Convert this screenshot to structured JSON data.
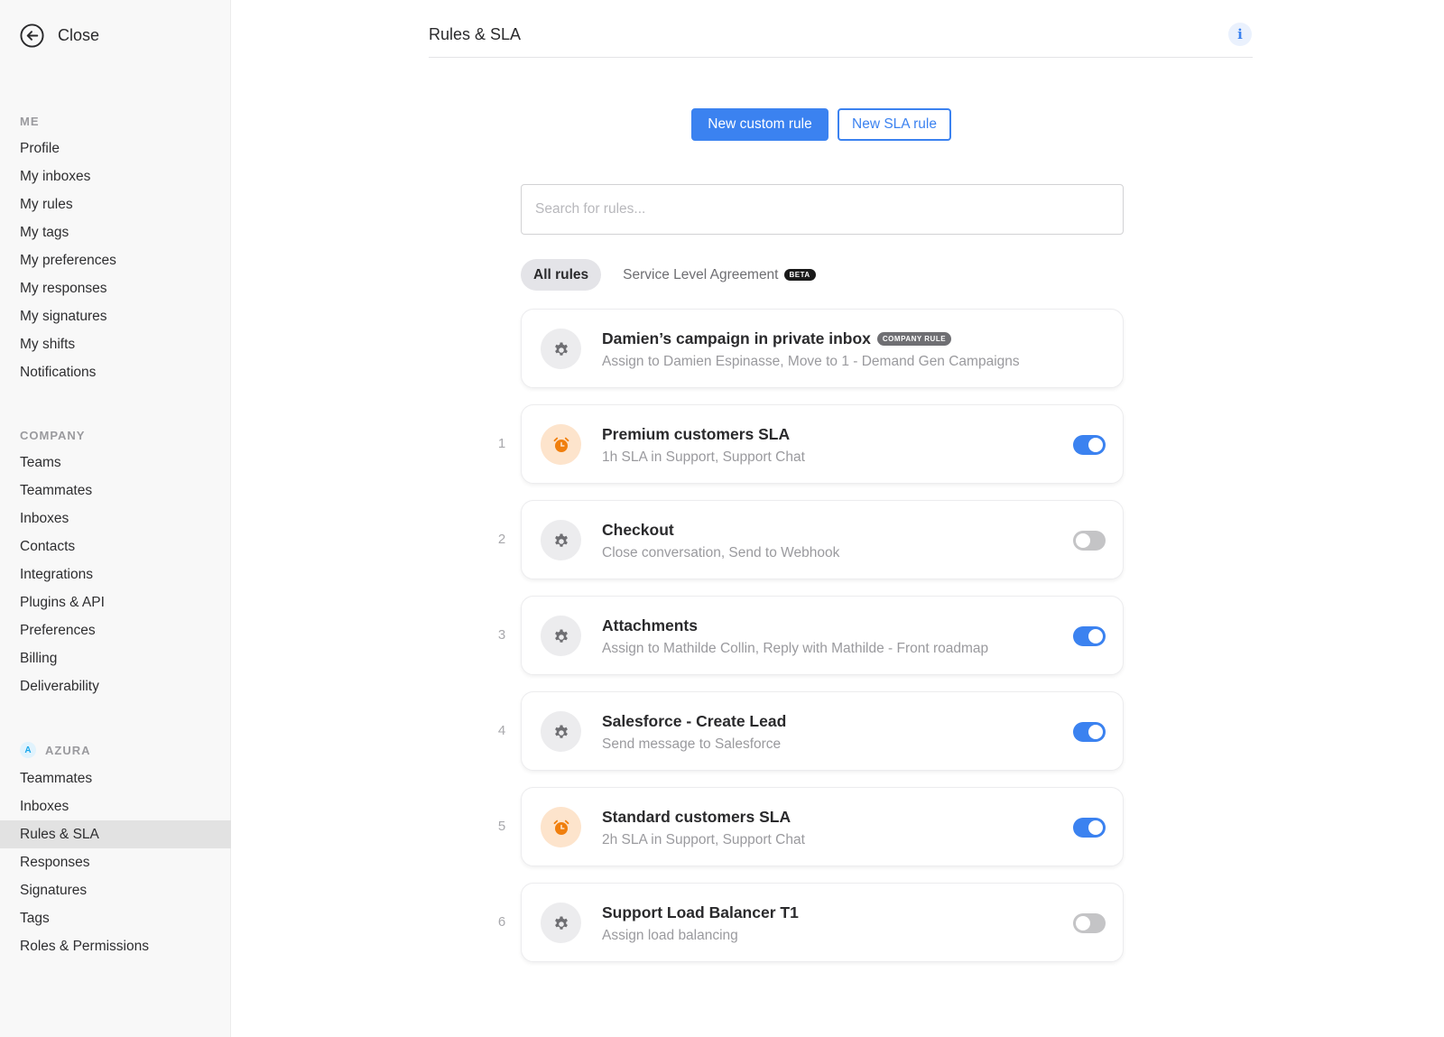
{
  "sidebar": {
    "close_label": "Close",
    "sections": [
      {
        "header": "ME",
        "items": [
          "Profile",
          "My inboxes",
          "My rules",
          "My tags",
          "My preferences",
          "My responses",
          "My signatures",
          "My shifts",
          "Notifications"
        ]
      },
      {
        "header": "COMPANY",
        "items": [
          "Teams",
          "Teammates",
          "Inboxes",
          "Contacts",
          "Integrations",
          "Plugins & API",
          "Preferences",
          "Billing",
          "Deliverability"
        ]
      },
      {
        "header": "AZURA",
        "badge": "A",
        "items": [
          "Teammates",
          "Inboxes",
          "Rules & SLA",
          "Responses",
          "Signatures",
          "Tags",
          "Roles & Permissions"
        ]
      }
    ],
    "active_item": "Rules & SLA"
  },
  "header": {
    "title": "Rules & SLA",
    "info_icon": "i"
  },
  "actions": {
    "new_custom_rule": "New custom rule",
    "new_sla_rule": "New SLA rule"
  },
  "search": {
    "placeholder": "Search for rules...",
    "value": ""
  },
  "tabs": [
    {
      "label": "All rules",
      "active": true
    },
    {
      "label": "Service Level Agreement",
      "badge": "BETA",
      "active": false
    }
  ],
  "rules": [
    {
      "index": "",
      "name": "Damien’s campaign in private inbox",
      "badge": "COMPANY RULE",
      "description": "Assign to Damien Espinasse, Move to 1 - Demand Gen Campaigns",
      "icon": "gear-icon",
      "enabled": null
    },
    {
      "index": "1",
      "name": "Premium customers SLA",
      "description": "1h SLA in Support, Support Chat",
      "icon": "alarm-clock-icon",
      "enabled": true
    },
    {
      "index": "2",
      "name": "Checkout",
      "description": "Close conversation, Send to Webhook",
      "icon": "gear-icon",
      "enabled": false
    },
    {
      "index": "3",
      "name": "Attachments",
      "description": "Assign to Mathilde Collin, Reply with Mathilde - Front roadmap",
      "icon": "gear-icon",
      "enabled": true
    },
    {
      "index": "4",
      "name": "Salesforce - Create Lead",
      "description": "Send message to Salesforce",
      "icon": "gear-icon",
      "enabled": true
    },
    {
      "index": "5",
      "name": "Standard customers SLA",
      "description": "2h SLA in Support, Support Chat",
      "icon": "alarm-clock-icon",
      "enabled": true
    },
    {
      "index": "6",
      "name": "Support Load Balancer T1",
      "description": "Assign load balancing",
      "icon": "gear-icon",
      "enabled": false
    }
  ],
  "colors": {
    "accent": "#3b82f0",
    "sla_orange": "#f07f0e",
    "sla_bg": "#fde4cc"
  }
}
